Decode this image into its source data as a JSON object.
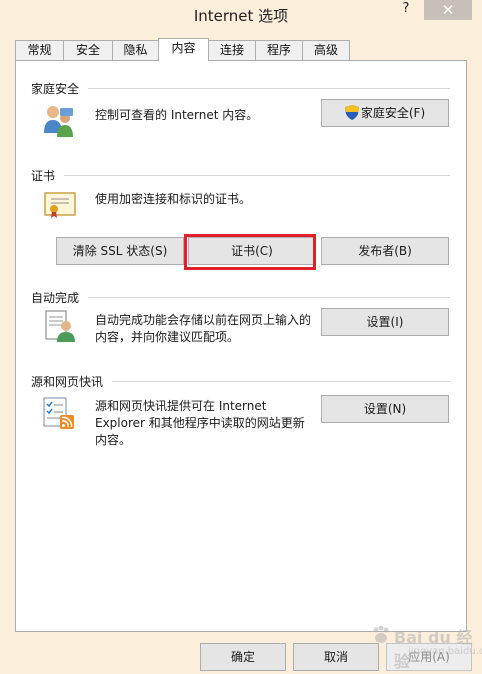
{
  "window": {
    "title": "Internet 选项",
    "help_label": "?",
    "close_label": "✕"
  },
  "tabs": [
    {
      "label": "常规"
    },
    {
      "label": "安全"
    },
    {
      "label": "隐私"
    },
    {
      "label": "内容",
      "active": true
    },
    {
      "label": "连接"
    },
    {
      "label": "程序"
    },
    {
      "label": "高级"
    }
  ],
  "family_safety": {
    "heading": "家庭安全",
    "description": "控制可查看的 Internet 内容。",
    "button_label": "家庭安全(F)",
    "icon": "family-users-icon"
  },
  "certificates": {
    "heading": "证书",
    "description": "使用加密连接和标识的证书。",
    "clear_ssl_label": "清除 SSL 状态(S)",
    "certificates_label": "证书(C)",
    "publishers_label": "发布者(B)",
    "icon": "certificate-icon"
  },
  "autocomplete": {
    "heading": "自动完成",
    "description_line1": "自动完成功能会存储以前在网页上输入的",
    "description_line2": "内容，并向你建议匹配项。",
    "button_label": "设置(I)",
    "icon": "autocomplete-form-icon"
  },
  "feeds": {
    "heading": "源和网页快讯",
    "description_line1": "源和网页快讯提供可在 Internet",
    "description_line2": "Explorer 和其他程序中读取的网站更新",
    "description_line3": "内容。",
    "button_label": "设置(N)",
    "icon": "rss-feed-icon"
  },
  "footer": {
    "ok_label": "确定",
    "cancel_label": "取消",
    "apply_label": "应用(A)"
  },
  "watermark": {
    "text": "Bai du 经验",
    "subtext": "jingyan.baidu.com"
  },
  "colors": {
    "frame": "#fbeedb",
    "highlight": "#e0202a"
  }
}
